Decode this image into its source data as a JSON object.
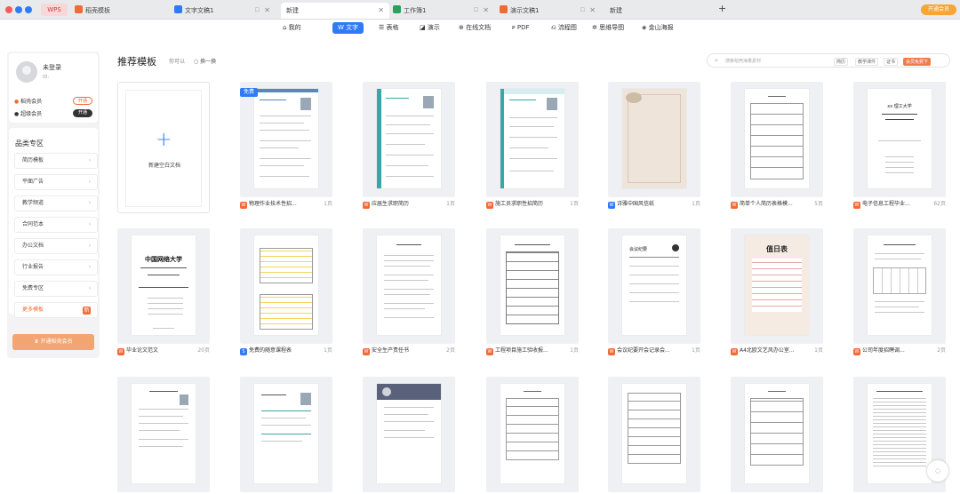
{
  "tabs": {
    "wps": "WPS",
    "template": "稻壳模板",
    "doc1": "文字文稿1",
    "new1": "新建",
    "ws1": "工作簿1",
    "ppt1": "演示文稿1",
    "new2": "新建"
  },
  "vip": "开通会员",
  "toolbar": {
    "mine": "我的",
    "word": "文字",
    "table": "表格",
    "ppt": "演示",
    "online": "在线文档",
    "pdf": "PDF",
    "flow": "流程图",
    "mind": "思维导图",
    "jinshan": "金山海报"
  },
  "user": {
    "name": "未登录",
    "id": "ID:",
    "vip1": "稻壳会员",
    "vip1_btn": "开通",
    "vip2": "超级会员",
    "vip2_btn": "开通"
  },
  "categories": {
    "title": "品类专区",
    "items": [
      "简历模板",
      "平面广告",
      "教学频道",
      "合同范本",
      "办公文档",
      "行业报告",
      "免费专区"
    ],
    "more": "更多模板",
    "more_badge": "新",
    "cta": "开通稻壳会员"
  },
  "header": {
    "title": "推荐模板",
    "sub": "你可以",
    "refresh": "换一换",
    "search_placeholder": "搜索稻壳海量素材",
    "chips": [
      "简历",
      "教学课件",
      "证书"
    ],
    "chip_orange": "会员免费下"
  },
  "newdoc": "新建空白文档",
  "free_tag": "免费",
  "row1": [
    {
      "name": "物理作业技术性招...",
      "pages": "1页"
    },
    {
      "name": "应届生求职简历",
      "pages": "1页"
    },
    {
      "name": "施工员求职性招简历",
      "pages": "1页"
    },
    {
      "name": "诗雅中国风信纸",
      "pages": "1页"
    },
    {
      "name": "简单个人简历表格模...",
      "pages": "5页"
    },
    {
      "name": "电子信息工程毕业...",
      "pages": "62页"
    }
  ],
  "row2": [
    {
      "name": "毕业论文范文",
      "pages": "20页"
    },
    {
      "name": "免费的随意课程表",
      "pages": "1页"
    },
    {
      "name": "安全生产责任书",
      "pages": "2页"
    },
    {
      "name": "工程项目施工验收报...",
      "pages": "1页"
    },
    {
      "name": "会议纪要开会记录会...",
      "pages": "1页"
    },
    {
      "name": "A4北欧文艺风办公室...",
      "pages": "1页"
    },
    {
      "name": "公司年度招聘调...",
      "pages": "2页"
    }
  ],
  "thumbtext": {
    "univ": "中国网络大学",
    "duty": "值日表",
    "meet": "会议纪要",
    "tech": "xx 理工大学"
  }
}
